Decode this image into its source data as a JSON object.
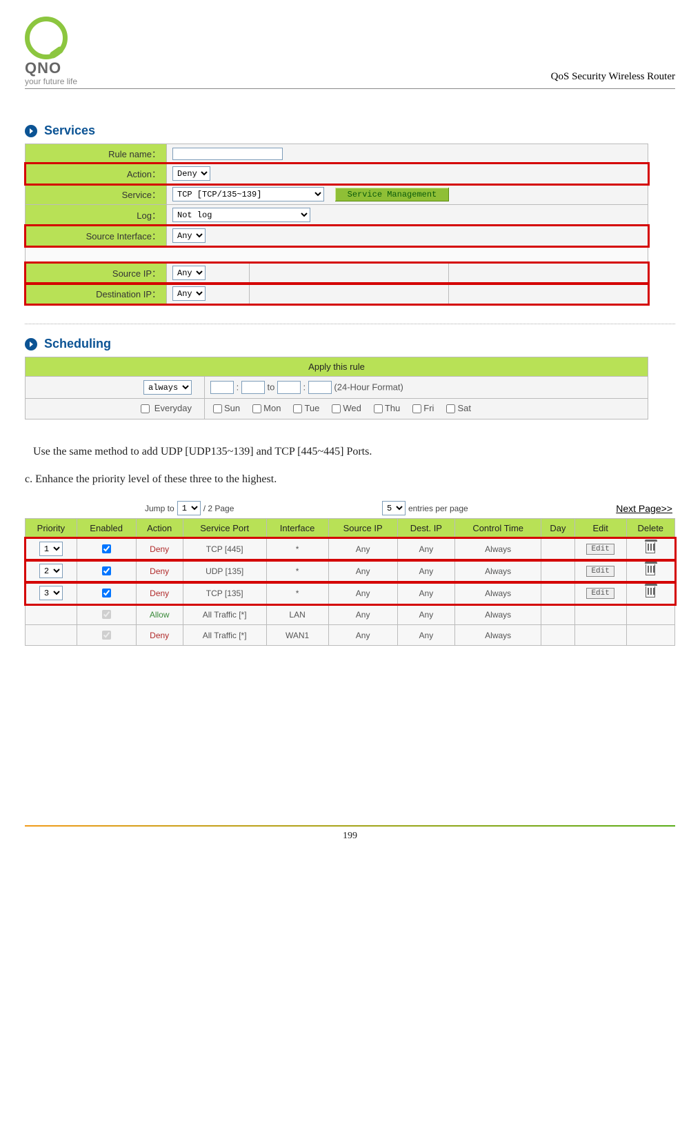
{
  "doc": {
    "title": "QoS Security Wireless Router",
    "logo_text": "QNO",
    "logo_sub": "your future life",
    "page": "199"
  },
  "services": {
    "title": "Services",
    "rows": {
      "rule_name": {
        "label": "Rule name：",
        "value": ""
      },
      "action": {
        "label": "Action：",
        "value": "Deny"
      },
      "service": {
        "label": "Service：",
        "value": "TCP [TCP/135~139]",
        "btn": "Service Management"
      },
      "log": {
        "label": "Log：",
        "value": "Not log"
      },
      "src_if": {
        "label": "Source Interface：",
        "value": "Any"
      },
      "src_ip": {
        "label": "Source IP：",
        "value": "Any"
      },
      "dst_ip": {
        "label": "Destination IP：",
        "value": "Any"
      }
    }
  },
  "scheduling": {
    "title": "Scheduling",
    "header": "Apply this rule",
    "mode": "always",
    "to": "to",
    "fmt": "(24-Hour Format)",
    "everyday": "Everyday",
    "days": [
      "Sun",
      "Mon",
      "Tue",
      "Wed",
      "Thu",
      "Fri",
      "Sat"
    ]
  },
  "text": {
    "p1": "Use the same method to add UDP [UDP135~139] and TCP [445~445] Ports.",
    "p2": "c. Enhance the priority level of these three to the highest."
  },
  "priority": {
    "jump_label": "Jump to",
    "jump_value": "1",
    "jump_pages": "/ 2 Page",
    "entries_value": "5",
    "entries_label": "entries per page",
    "next": "Next Page>>",
    "headers": [
      "Priority",
      "Enabled",
      "Action",
      "Service Port",
      "Interface",
      "Source IP",
      "Dest. IP",
      "Control Time",
      "Day",
      "Edit",
      "Delete"
    ],
    "rows": [
      {
        "priority": "1",
        "enabled": true,
        "enabled_locked": false,
        "action": "Deny",
        "action_class": "deny",
        "port": "TCP [445]",
        "iface": "*",
        "src": "Any",
        "dst": "Any",
        "ctime": "Always",
        "day": "",
        "edit": true,
        "del": true,
        "hl": true
      },
      {
        "priority": "2",
        "enabled": true,
        "enabled_locked": false,
        "action": "Deny",
        "action_class": "deny",
        "port": "UDP [135]",
        "iface": "*",
        "src": "Any",
        "dst": "Any",
        "ctime": "Always",
        "day": "",
        "edit": true,
        "del": true,
        "hl": true
      },
      {
        "priority": "3",
        "enabled": true,
        "enabled_locked": false,
        "action": "Deny",
        "action_class": "deny",
        "port": "TCP [135]",
        "iface": "*",
        "src": "Any",
        "dst": "Any",
        "ctime": "Always",
        "day": "",
        "edit": true,
        "del": true,
        "hl": true
      },
      {
        "priority": "",
        "enabled": true,
        "enabled_locked": true,
        "action": "Allow",
        "action_class": "allow",
        "port": "All Traffic [*]",
        "iface": "LAN",
        "src": "Any",
        "dst": "Any",
        "ctime": "Always",
        "day": "",
        "edit": false,
        "del": false,
        "hl": false
      },
      {
        "priority": "",
        "enabled": true,
        "enabled_locked": true,
        "action": "Deny",
        "action_class": "deny",
        "port": "All Traffic [*]",
        "iface": "WAN1",
        "src": "Any",
        "dst": "Any",
        "ctime": "Always",
        "day": "",
        "edit": false,
        "del": false,
        "hl": false
      }
    ],
    "edit_label": "Edit"
  }
}
